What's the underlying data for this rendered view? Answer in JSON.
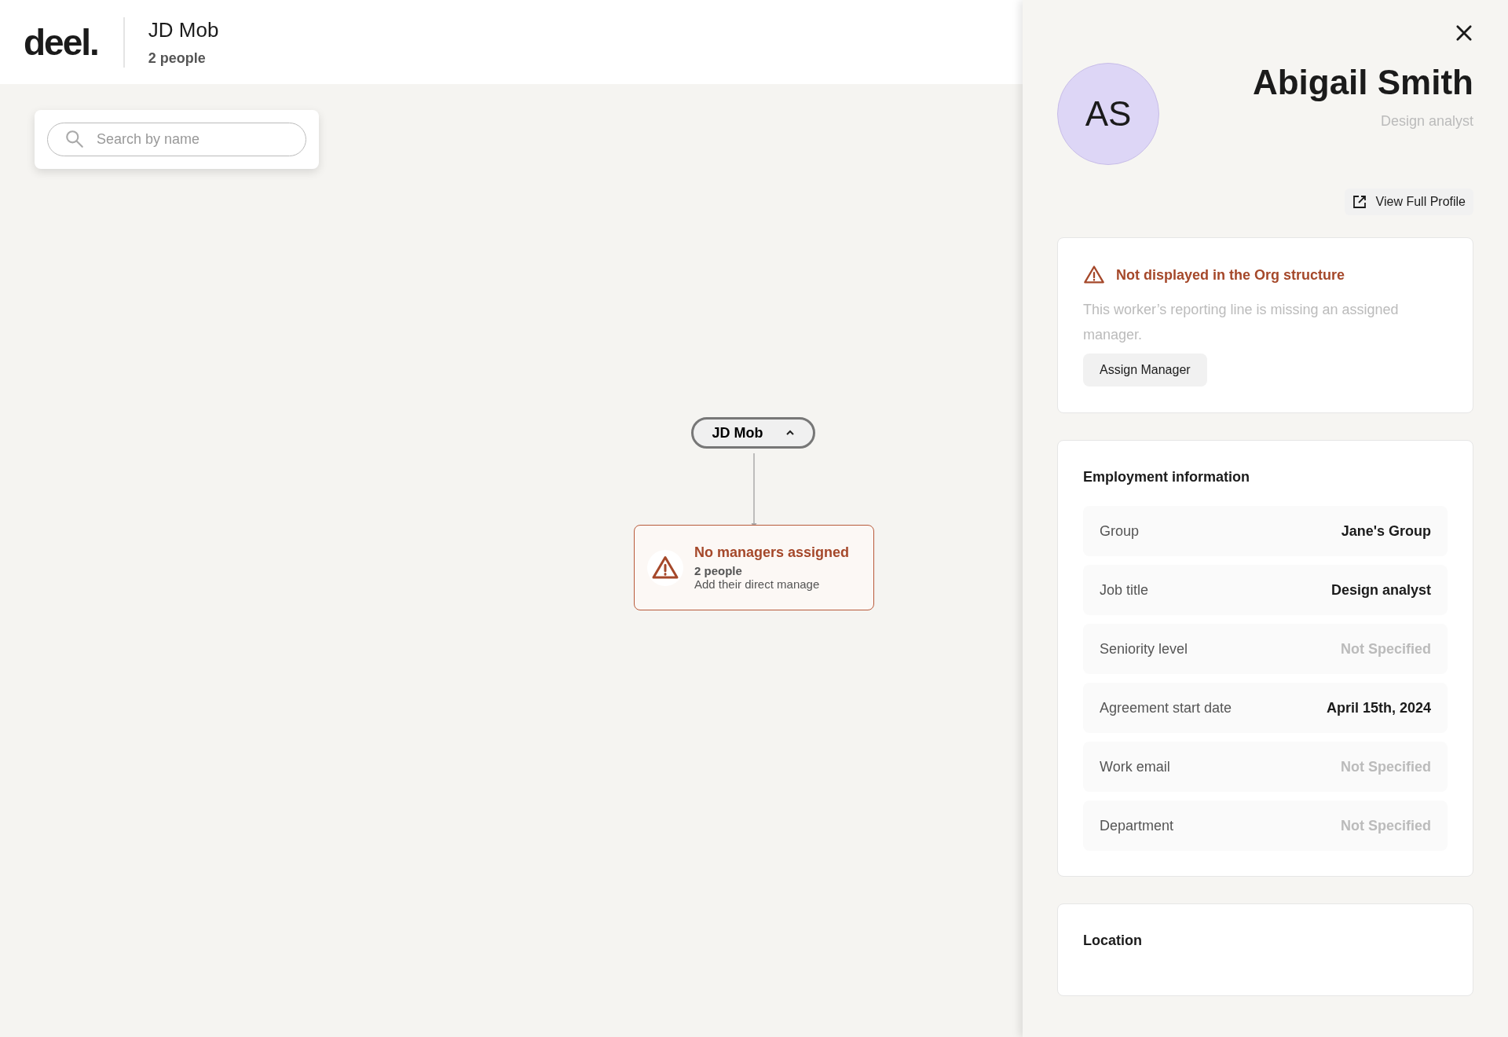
{
  "header": {
    "logo": "deel.",
    "title": "JD Mob",
    "subtitle": "2 people"
  },
  "search": {
    "placeholder": "Search by name"
  },
  "chart_nodes": {
    "root": {
      "label": "JD Mob",
      "expanded": true
    },
    "warning": {
      "title": "No managers assigned",
      "count": "2 people",
      "hint": "Add their direct manage"
    }
  },
  "panel": {
    "initials": "AS",
    "name": "Abigail Smith",
    "role": "Design analyst",
    "profile_button": "View Full Profile",
    "alert": {
      "title": "Not displayed in the Org structure",
      "text": "This worker’s reporting line is missing an assigned manager.",
      "button": "Assign Manager"
    },
    "employment": {
      "heading": "Employment information",
      "rows": [
        {
          "label": "Group",
          "value": "Jane's Group",
          "specified": true
        },
        {
          "label": "Job title",
          "value": "Design analyst",
          "specified": true
        },
        {
          "label": "Seniority level",
          "value": "Not Specified",
          "specified": false
        },
        {
          "label": "Agreement start date",
          "value": "April 15th, 2024",
          "specified": true
        },
        {
          "label": "Work email",
          "value": "Not Specified",
          "specified": false
        },
        {
          "label": "Department",
          "value": "Not Specified",
          "specified": false
        }
      ]
    },
    "location": {
      "heading": "Location"
    }
  }
}
